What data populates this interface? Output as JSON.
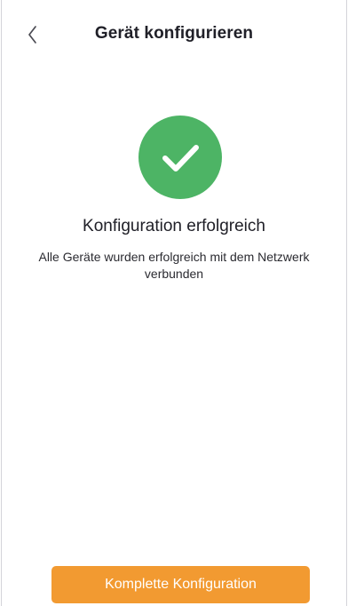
{
  "header": {
    "title": "Gerät konfigurieren",
    "back_icon": "chevron-left-icon"
  },
  "status": {
    "icon": "checkmark-icon",
    "icon_color": "#4db465",
    "title": "Konfiguration erfolgreich",
    "message": "Alle Geräte wurden erfolgreich mit dem Netzwerk verbunden"
  },
  "actions": {
    "complete_label": "Komplette Konfiguration",
    "accent_color": "#f29a31"
  }
}
